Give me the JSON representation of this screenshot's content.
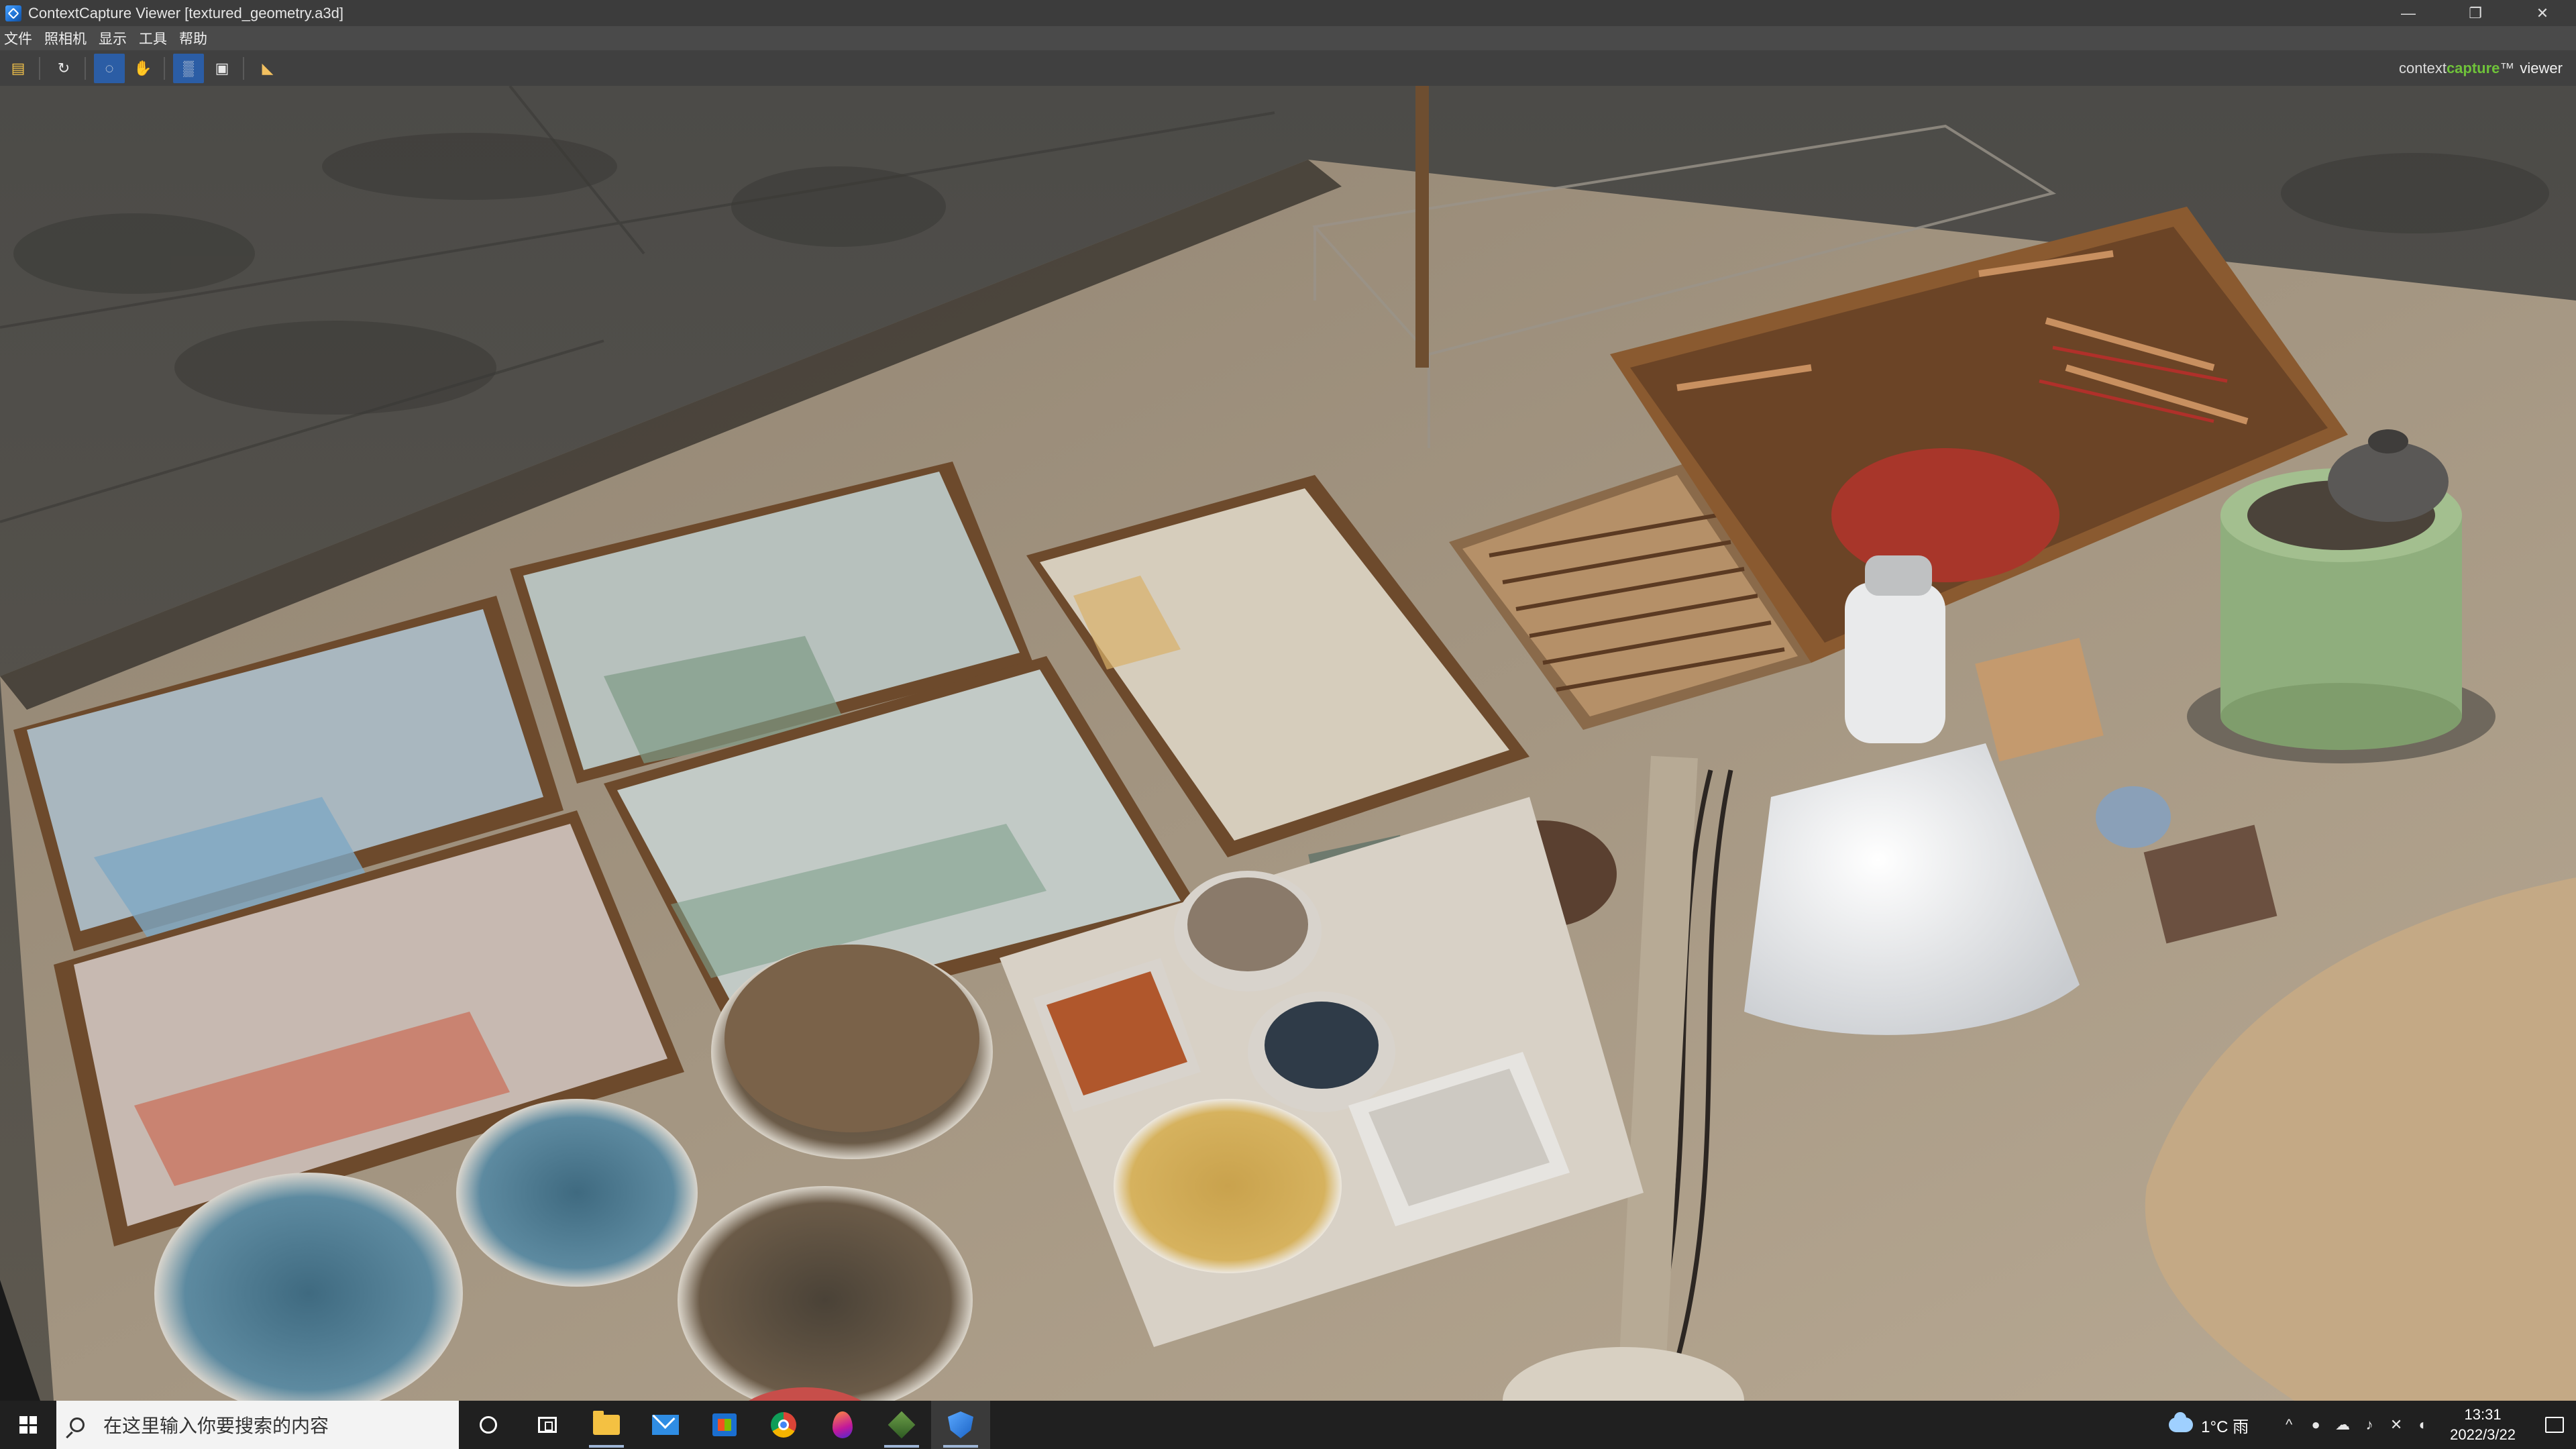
{
  "window": {
    "title": "ContextCapture Viewer [textured_geometry.a3d]",
    "controls": [
      "—",
      "❐",
      "✕"
    ]
  },
  "menu": {
    "items": [
      "文件",
      "照相机",
      "显示",
      "工具",
      "帮助"
    ]
  },
  "toolbar": {
    "buttons": [
      "open-folder-icon",
      "orbit-icon",
      "rotate-mode-icon",
      "pan-hand-icon",
      "shading-grid-icon",
      "texture-toggle-icon",
      "measure-icon"
    ],
    "glyphs": [
      "▤",
      "↻",
      "◌",
      "✋",
      "▒",
      "▣",
      "◣"
    ]
  },
  "brand": {
    "part1": "context",
    "part2": "capture",
    "tm": "™",
    "part3": "viewer"
  },
  "taskbar": {
    "search_placeholder": "在这里输入你要搜索的内容",
    "weather": "1°C 雨",
    "time": "13:31",
    "date": "2022/3/22",
    "tray_glyphs": [
      "^",
      "●",
      "☁",
      "♪",
      "✕",
      "◐"
    ]
  }
}
